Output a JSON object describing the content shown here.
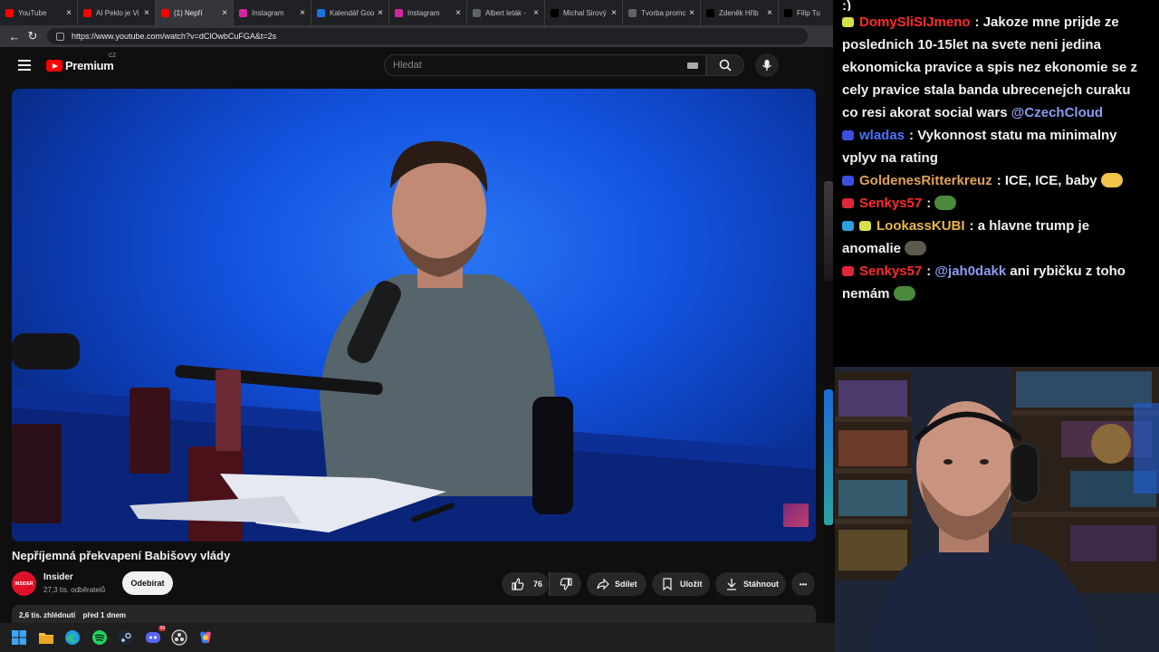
{
  "browser": {
    "tabs": [
      {
        "label": "YouTube",
        "fav_color": "#ff0000"
      },
      {
        "label": "AI Peklo je Vi",
        "fav_color": "#ff0000"
      },
      {
        "label": "(1) Nepří",
        "fav_color": "#ff0000",
        "active": true
      },
      {
        "label": "Instagram",
        "fav_color": "#d6249f"
      },
      {
        "label": "Kalendář Goo",
        "fav_color": "#1a73e8"
      },
      {
        "label": "Instagram",
        "fav_color": "#d6249f"
      },
      {
        "label": "Albert leták -",
        "fav_color": "#5f6368"
      },
      {
        "label": "Michal Sirový",
        "fav_color": "#000000"
      },
      {
        "label": "Tvorba promc",
        "fav_color": "#5f6368"
      },
      {
        "label": "Zdeněk Hřib",
        "fav_color": "#000000"
      },
      {
        "label": "Filip Tu",
        "fav_color": "#000000"
      }
    ],
    "url": "https://www.youtube.com/watch?v=dClOwbCuFGA&t=2s"
  },
  "youtube": {
    "logo_text": "Premium",
    "country": "CZ",
    "search_placeholder": "Hledat"
  },
  "video": {
    "title": "Nepříjemná překvapení Babišovy vlády",
    "channel": "Insider",
    "channel_avatar_text": "INSIDER",
    "subscribers": "27,3 tis. odběratelů",
    "subscribe_label": "Odebírat",
    "likes": "76",
    "share_label": "Sdílet",
    "save_label": "Uložit",
    "download_label": "Stáhnout",
    "more_label": "•••",
    "views": "2,6 tis. zhlédnutí",
    "published": "před 1 dnem"
  },
  "chat": {
    "messages": [
      {
        "badge_colors": [
          "#d7e04a"
        ],
        "user": "DomySliSIJmeno",
        "user_color": "#ff2b2b",
        "text": ": Jakoze mne prijde ze poslednich 10-15let na svete neni jedina ekonomicka pravice a spis nez ekonomie se z cely pravice stala banda ubrecenejch curaku co resi akorat social wars",
        "mention": "@CzechCloud"
      },
      {
        "badge_colors": [
          "#3d4fe0"
        ],
        "user": "wladas",
        "user_color": "#4a73ff",
        "text": ": Vykonnost statu ma minimalny vplyv na rating",
        "mention": ""
      },
      {
        "badge_colors": [
          "#3d4fe0"
        ],
        "user": "GoldenesRitterkreuz",
        "user_color": "#e0a15a",
        "text": ": ICE, ICE, baby",
        "mention": ""
      },
      {
        "badge_colors": [
          "#e0263a"
        ],
        "user": "Senkys57",
        "user_color": "#ff2b2b",
        "text": ":",
        "mention": ""
      },
      {
        "badge_colors": [
          "#2aa0e0",
          "#d7e04a"
        ],
        "user": "LookassKUBI",
        "user_color": "#e8b84a",
        "text": ": a hlavne trump je anomalie",
        "mention": ""
      },
      {
        "badge_colors": [
          "#e0263a"
        ],
        "user": "Senkys57",
        "user_color": "#ff2b2b",
        "text": "ani rybičku z toho nemám",
        "mention": "@jah0dakk",
        "mention_first": true
      }
    ],
    "partial_top": ":)"
  },
  "taskbar": {
    "icons": [
      "windows-icon",
      "file-explorer-icon",
      "edge-icon",
      "spotify-icon",
      "steam-icon",
      "discord-icon",
      "obs-icon",
      "copilot-icon"
    ],
    "discord_badge": "99"
  }
}
